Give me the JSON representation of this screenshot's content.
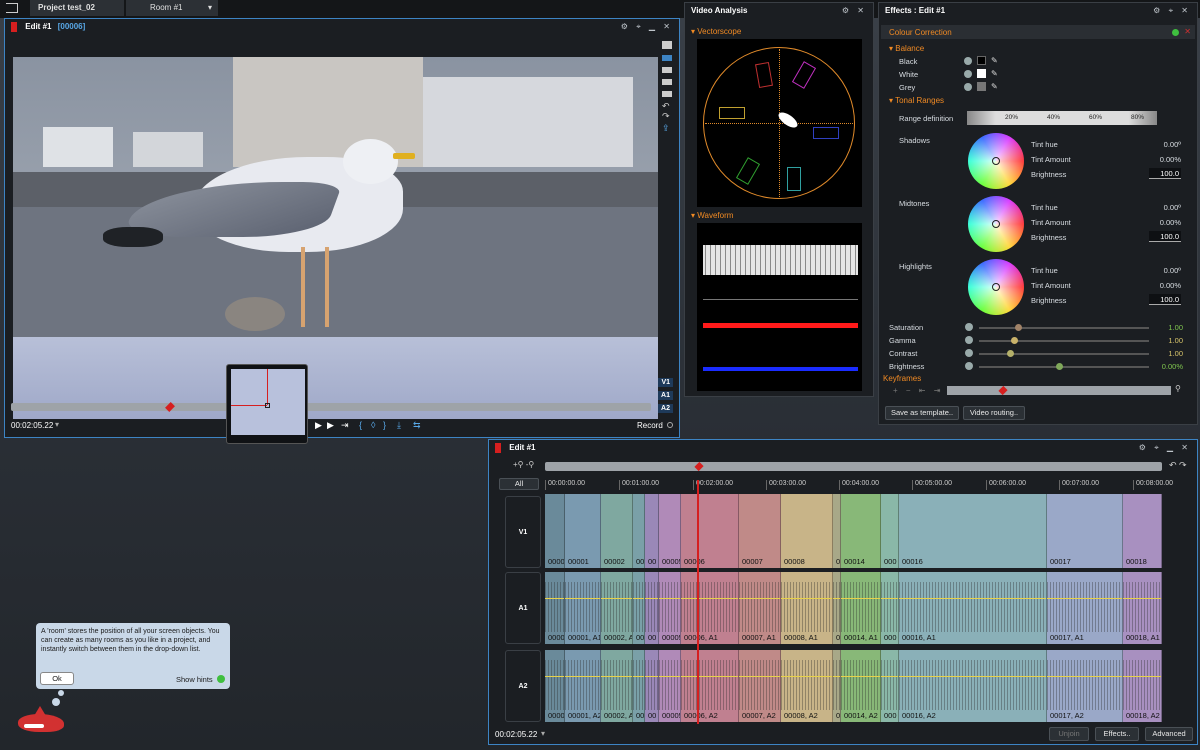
{
  "topbar": {
    "project": "Project test_02",
    "room": "Room #1",
    "room_arrow": "▾"
  },
  "viewer": {
    "title": "Edit #1",
    "clip_id": "[00006]",
    "timecode": "00:02:05.22",
    "record_label": "Record",
    "track_labels": [
      "V1",
      "A1",
      "A2"
    ]
  },
  "video_analysis": {
    "title": "Video Analysis",
    "vectorscope_label": "Vectorscope",
    "waveform_label": "Waveform"
  },
  "effects": {
    "title": "Effects : Edit #1",
    "colour_correction": "Colour Correction",
    "balance": "Balance",
    "balance_items": [
      "Black",
      "White",
      "Grey"
    ],
    "tonal_ranges": "Tonal Ranges",
    "range_definition": "Range definition",
    "range_ticks": [
      "20%",
      "40%",
      "60%",
      "80%"
    ],
    "wheels": [
      {
        "name": "Shadows",
        "tint_hue": "0.00º",
        "tint_amount": "0.00%",
        "brightness": "100.0"
      },
      {
        "name": "Midtones",
        "tint_hue": "0.00º",
        "tint_amount": "0.00%",
        "brightness": "100.0"
      },
      {
        "name": "Highlights",
        "tint_hue": "0.00º",
        "tint_amount": "0.00%",
        "brightness": "100.0"
      }
    ],
    "wheel_params": [
      "Tint hue",
      "Tint Amount",
      "Brightness"
    ],
    "sliders": [
      {
        "name": "Saturation",
        "value": "1.00"
      },
      {
        "name": "Gamma",
        "value": "1.00"
      },
      {
        "name": "Contrast",
        "value": "1.00"
      },
      {
        "name": "Brightness",
        "value": "0.00%"
      }
    ],
    "keyframes": "Keyframes",
    "save_template": "Save as template..",
    "video_routing": "Video routing.."
  },
  "timeline": {
    "title": "Edit #1",
    "all_label": "All",
    "timecode": "00:02:05.22",
    "ruler": [
      "00:00:00.00",
      "00:01:00.00",
      "00:02:00.00",
      "00:03:00.00",
      "00:04:00.00",
      "00:05:00.00",
      "00:06:00.00",
      "00:07:00.00",
      "00:08:00.00"
    ],
    "tracks": [
      "V1",
      "A1",
      "A2"
    ],
    "v1_clips": [
      "0000",
      "00001",
      "00002",
      "000",
      "00",
      "00005",
      "00006",
      "00007",
      "00008",
      "0",
      "00014",
      "000",
      "00016",
      "00017",
      "00018"
    ],
    "a1_clips": [
      "0000",
      "00001, A1",
      "00002, A",
      "000",
      "00",
      "00005",
      "00006, A1",
      "00007, A1",
      "00008, A1",
      "0",
      "00014, A1",
      "000",
      "00016, A1",
      "00017, A1",
      "00018, A1"
    ],
    "a2_clips": [
      "0000",
      "00001, A2",
      "00002, A",
      "000",
      "00",
      "00005",
      "00006, A2",
      "00007, A2",
      "00008, A2",
      "0",
      "00014, A2",
      "000",
      "00016, A2",
      "00017, A2",
      "00018, A2"
    ],
    "unjoin": "Unjoin",
    "effects_btn": "Effects..",
    "advanced": "Advanced"
  },
  "hint": {
    "text": "A 'room' stores the position of all your screen objects. You can create as many rooms as you like in a project, and instantly switch between them in the drop-down list.",
    "ok": "Ok",
    "show_hints": "Show hints"
  }
}
